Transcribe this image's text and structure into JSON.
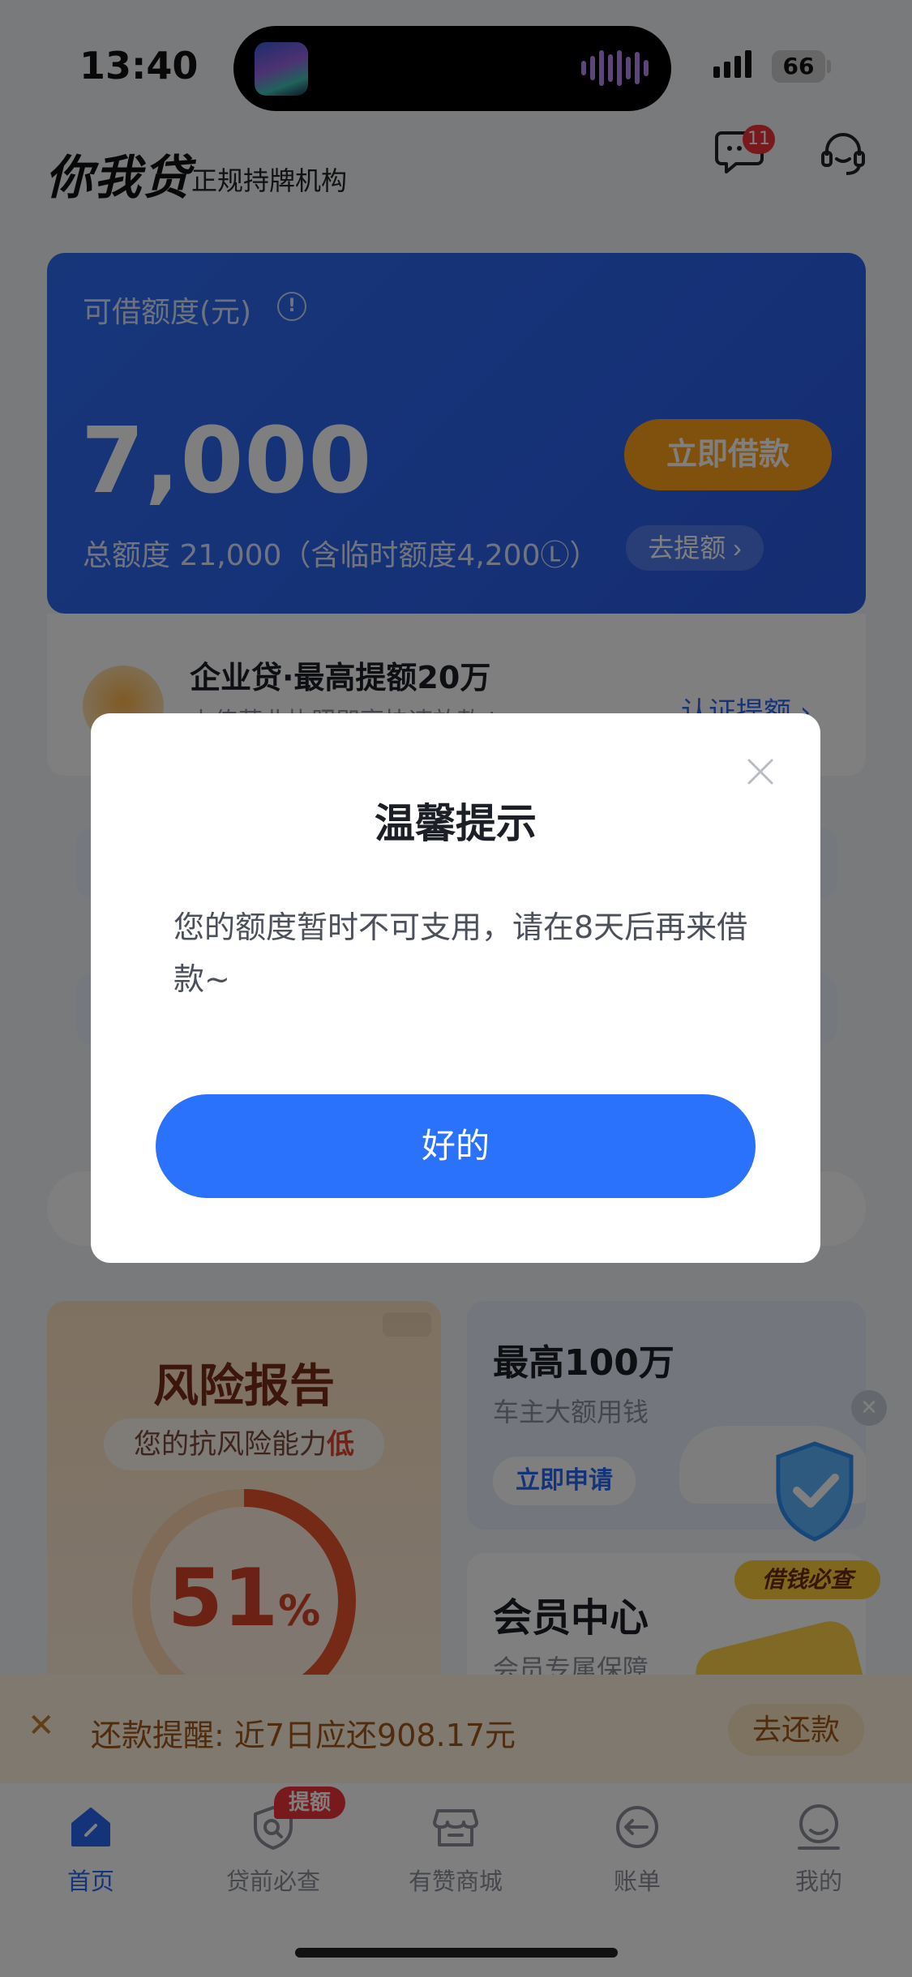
{
  "status_bar": {
    "time": "13:40",
    "battery": "66"
  },
  "header": {
    "logo": "你我贷",
    "subtitle": "正规持牌机构",
    "message_badge": "11"
  },
  "credit_card": {
    "label": "可借额度(元)",
    "amount": "7,000",
    "borrow_button": "立即借款",
    "total": "总额度 21,000（含临时额度4,200Ⓛ）",
    "raise_button": "去提额 ›"
  },
  "business_loan": {
    "title": "企业贷·最高提额20万",
    "subtitle": "上传营业执照即享快速放款↓",
    "link": "认证提额 ›"
  },
  "risk_card": {
    "title": "风险报告",
    "pill_prefix": "您的抗风险能力",
    "pill_emph": "低",
    "percent": "51",
    "percent_unit": "%"
  },
  "car_card": {
    "title": "最高100万",
    "subtitle": "车主大额用钱",
    "button": "立即申请"
  },
  "vip_card": {
    "title": "会员中心",
    "subtitle": "会员专属保障"
  },
  "float_ad": {
    "tag": "借钱必查",
    "close": "✕"
  },
  "banner": {
    "close": "✕",
    "text": "还款提醒: 近7日应还908.17元",
    "button": "去还款"
  },
  "tabbar": {
    "tabs": [
      {
        "label": "首页",
        "icon": "home-icon",
        "active": true
      },
      {
        "label": "贷前必查",
        "icon": "search-shield-icon",
        "active": false
      },
      {
        "label": "有赞商城",
        "icon": "store-icon",
        "active": false
      },
      {
        "label": "账单",
        "icon": "bill-icon",
        "active": false
      },
      {
        "label": "我的",
        "icon": "profile-icon",
        "active": false
      }
    ],
    "badge": "提额"
  },
  "dialog": {
    "title": "温馨提示",
    "message": "您的额度暂时不可支用，请在8天后再来借款~",
    "ok_button": "好的"
  },
  "colors": {
    "primary": "#2a72fb",
    "accent": "#ffa21a",
    "badge": "#f0343b"
  }
}
